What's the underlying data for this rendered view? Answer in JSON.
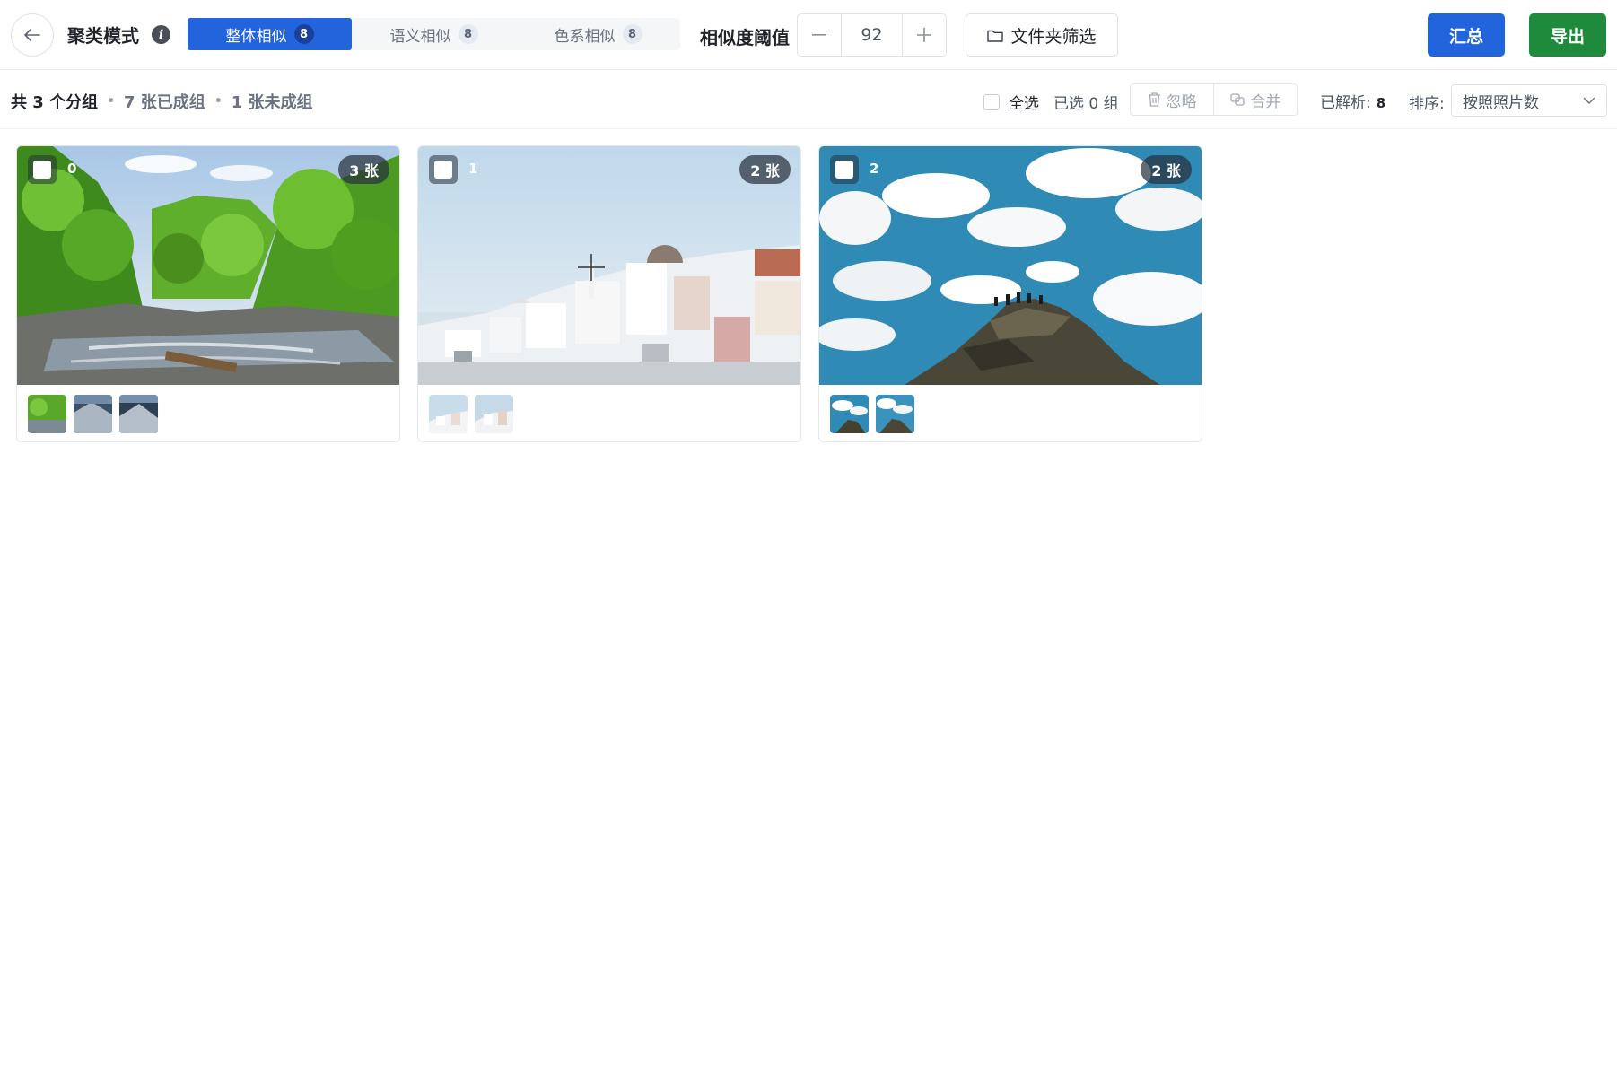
{
  "header": {
    "title": "聚类模式",
    "modes": [
      {
        "label": "整体相似",
        "count": "8",
        "active": true
      },
      {
        "label": "语义相似",
        "count": "8",
        "active": false
      },
      {
        "label": "色系相似",
        "count": "8",
        "active": false
      }
    ],
    "threshold_label": "相似度阈值",
    "threshold_value": "92",
    "folder_filter_label": "文件夹筛选",
    "summary_label": "汇总",
    "export_label": "导出"
  },
  "toolbar": {
    "groups_text": "共 3 个分组",
    "grouped_text": "7 张已成组",
    "ungrouped_text": "1 张未成组",
    "select_all_label": "全选",
    "selected_text": "已选 0 组",
    "ignore_label": "忽略",
    "merge_label": "合并",
    "parsed_label": "已解析:",
    "parsed_count": "8",
    "sort_label": "排序:",
    "sort_value": "按照照片数"
  },
  "groups": [
    {
      "index": "0",
      "count_label": "3 张",
      "theme": "forest-waterfall",
      "thumb_count": 3
    },
    {
      "index": "1",
      "count_label": "2 张",
      "theme": "santorini-village",
      "thumb_count": 2
    },
    {
      "index": "2",
      "count_label": "2 张",
      "theme": "sky-rock-summit",
      "thumb_count": 2
    }
  ],
  "colors": {
    "primary": "#2264dc",
    "export_green": "#1e8a3b"
  }
}
